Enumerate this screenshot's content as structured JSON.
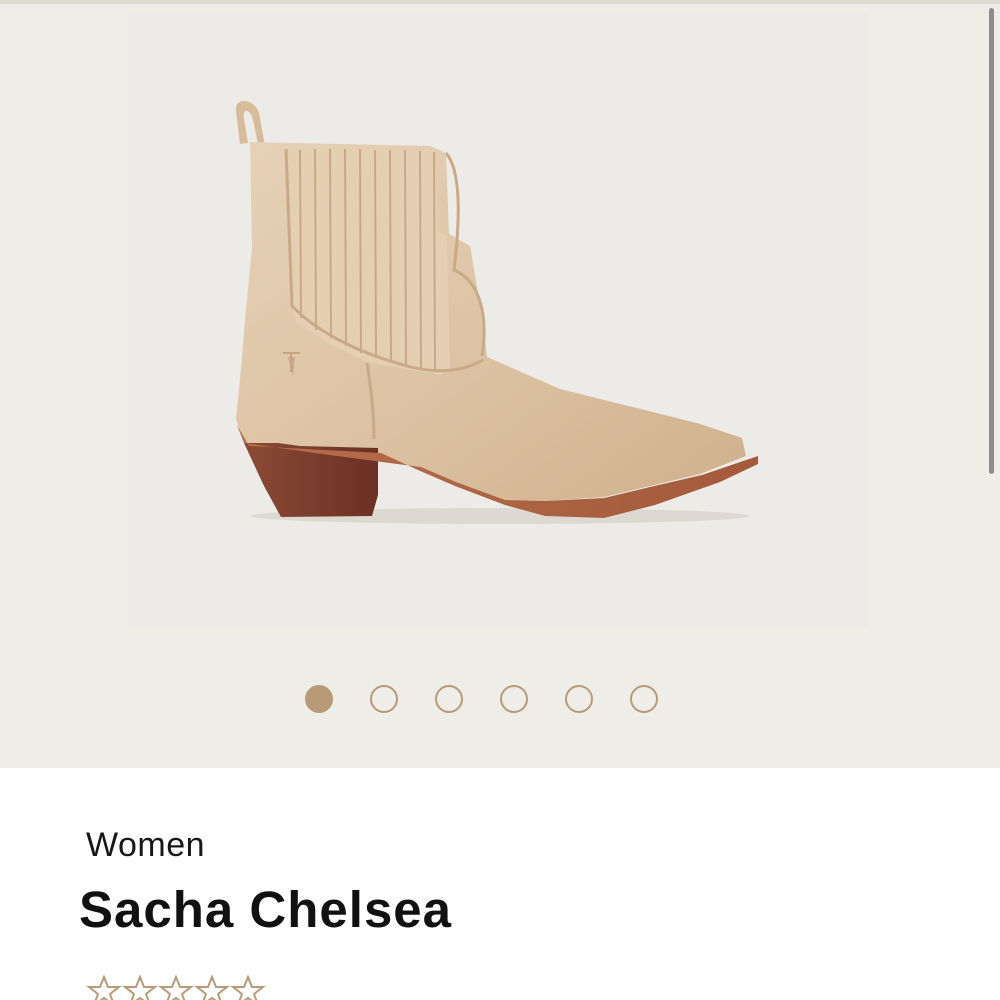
{
  "gallery": {
    "image_name": "sacha-chelsea-boot-image",
    "dot_count": 6,
    "active_index": 0,
    "accent_color": "#b99a76"
  },
  "product": {
    "category": "Women",
    "name": "Sacha Chelsea",
    "rating": {
      "max_stars": 5,
      "filled_stars": 0,
      "star_color": "#b99a76"
    }
  }
}
